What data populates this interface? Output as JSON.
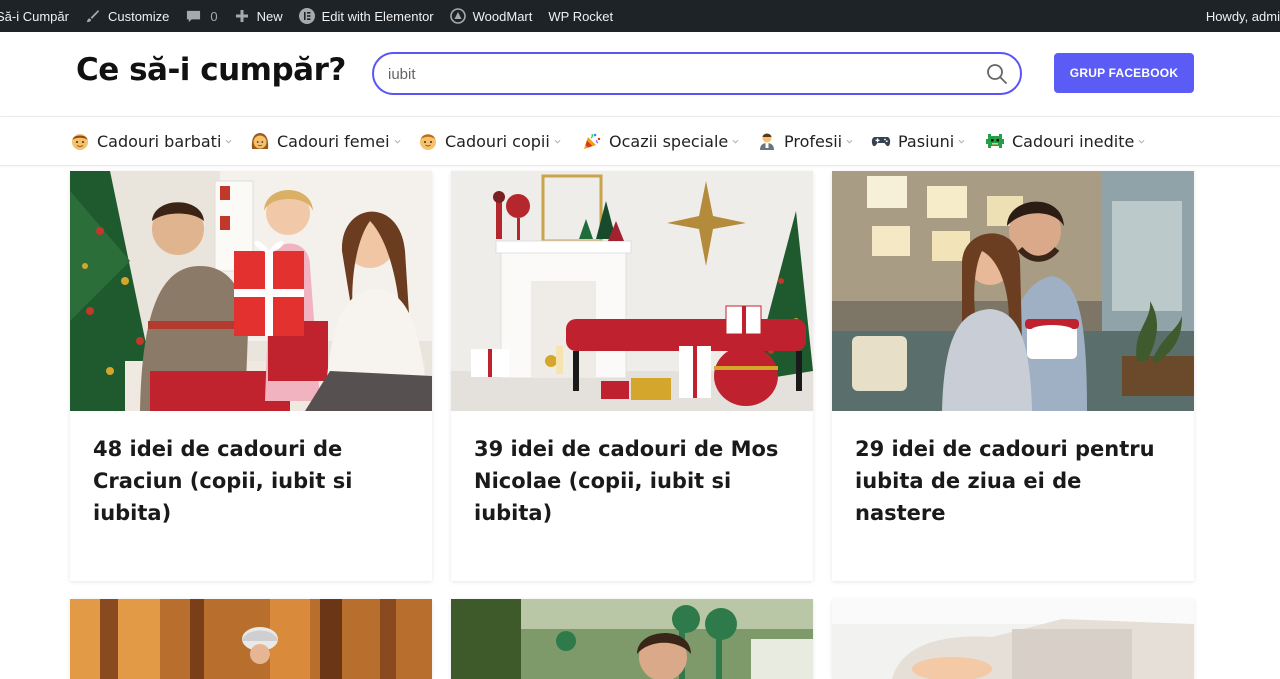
{
  "admin_bar": {
    "site_name": "Să-i Cumpăr",
    "customize": "Customize",
    "comments_count": "0",
    "new": "New",
    "edit_elementor": "Edit with Elementor",
    "woodmart": "WoodMart",
    "wp_rocket": "WP Rocket",
    "howdy": "Howdy, admi"
  },
  "header": {
    "logo": "Ce să-i cumpăr?",
    "search_value": "iubit",
    "facebook_button": "GRUP FACEBOOK"
  },
  "colors": {
    "accent": "#5b5cf6",
    "search_border": "#5b55f5",
    "admin_bar_bg": "#1d2327"
  },
  "nav": {
    "items": [
      {
        "label": "Cadouri barbati",
        "icon": "man-emoji-icon"
      },
      {
        "label": "Cadouri femei",
        "icon": "woman-emoji-icon"
      },
      {
        "label": "Cadouri copii",
        "icon": "child-emoji-icon"
      },
      {
        "label": "Ocazii speciale",
        "icon": "party-popper-icon"
      },
      {
        "label": "Profesii",
        "icon": "worker-emoji-icon"
      },
      {
        "label": "Pasiuni",
        "icon": "game-controller-icon"
      },
      {
        "label": "Cadouri inedite",
        "icon": "alien-monster-icon"
      }
    ]
  },
  "posts": [
    {
      "title": "48 idei de cadouri de Craciun (copii, iubit si iubita)",
      "image": "family-christmas-gift-photo"
    },
    {
      "title": "39 idei de cadouri de Mos Nicolae (copii, iubit si iubita)",
      "image": "christmas-room-decor-photo"
    },
    {
      "title": "29 idei de cadouri pentru iubita de ziua ei de nastere",
      "image": "couple-gift-photo"
    },
    {
      "title": "",
      "image": "cyclist-autumn-photo"
    },
    {
      "title": "",
      "image": "man-outdoor-photo"
    },
    {
      "title": "",
      "image": "bright-room-photo"
    }
  ]
}
